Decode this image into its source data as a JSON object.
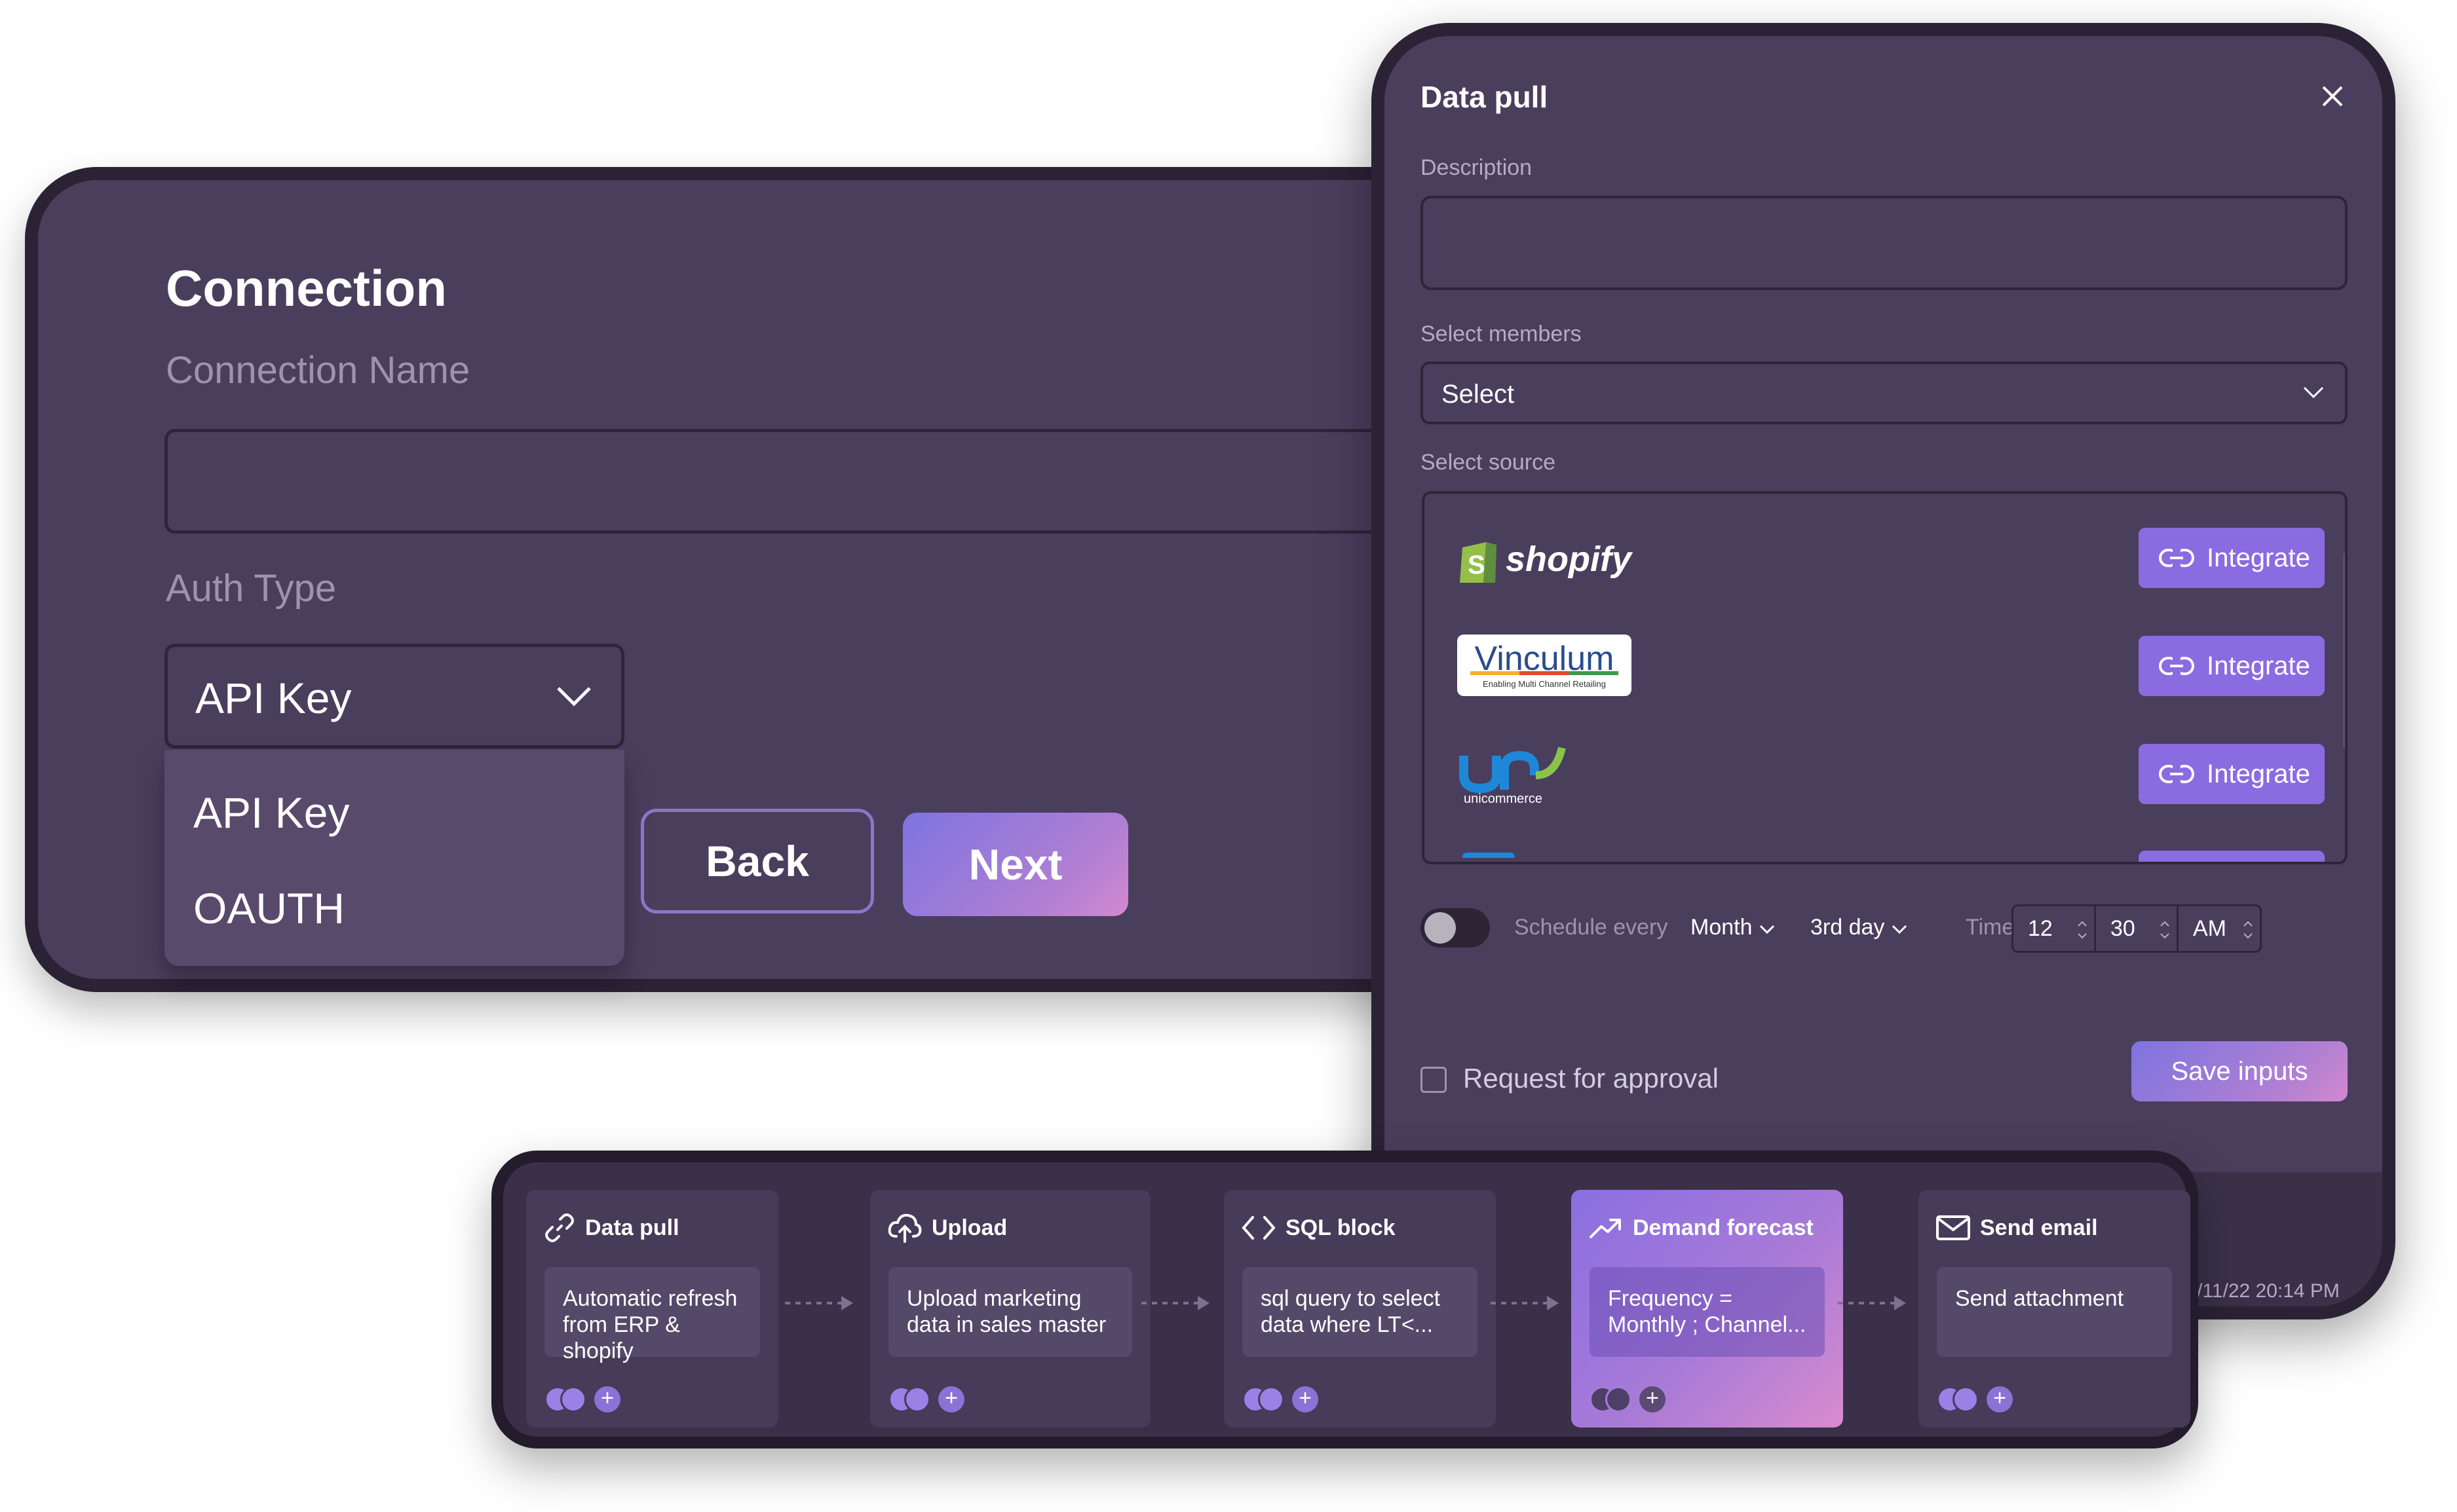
{
  "connection": {
    "title": "Connection",
    "name_label": "Connection Name",
    "name_value": "",
    "auth_label": "Auth Type",
    "auth_selected": "API Key",
    "auth_options": [
      "API Key",
      "OAUTH"
    ],
    "back_label": "Back",
    "next_label": "Next"
  },
  "dialog": {
    "title": "Data pull",
    "description_label": "Description",
    "description_value": "",
    "members_label": "Select members",
    "members_value": "Select",
    "source_label": "Select source",
    "sources": [
      {
        "name": "shopify",
        "logo": "shopify-logo",
        "action": "Integrate"
      },
      {
        "name": "Vinculum",
        "tagline": "Enabling Multi Channel Retailing",
        "logo": "vinculum-logo",
        "action": "Integrate"
      },
      {
        "name": "unicommerce",
        "logo": "unicommerce-logo",
        "action": "Integrate"
      }
    ],
    "schedule": {
      "enabled": false,
      "label": "Schedule every",
      "period": "Month",
      "day": "3rd day",
      "time_label": "Time",
      "hour": "12",
      "minute": "30",
      "ampm": "AM"
    },
    "approval_label": "Request for approval",
    "save_label": "Save inputs",
    "footer_timestamp": "/11/22 20:14 PM"
  },
  "pipeline": {
    "steps": [
      {
        "icon": "link-icon",
        "title": "Data pull",
        "body": "Automatic refresh from ERP & shopify",
        "active": false
      },
      {
        "icon": "upload-icon",
        "title": "Upload",
        "body": "Upload marketing data in sales master",
        "active": false
      },
      {
        "icon": "code-icon",
        "title": "SQL block",
        "body": "sql query to select data where LT<...",
        "active": false
      },
      {
        "icon": "trending-up-icon",
        "title": "Demand forecast",
        "body": "Frequency = Monthly ; Channel...",
        "active": true
      },
      {
        "icon": "mail-icon",
        "title": "Send email",
        "body": "Send attachment",
        "active": false
      }
    ]
  },
  "colors": {
    "panel_bg": "#4a3e5d",
    "frame": "#2b2235",
    "accent": "#8b6be0",
    "gradient_start": "#7e74e0",
    "gradient_end": "#d389cf"
  }
}
